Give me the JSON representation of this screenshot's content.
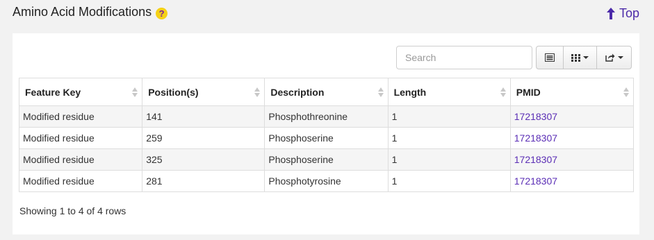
{
  "header": {
    "title": "Amino Acid Modifications",
    "help_glyph": "?",
    "top_label": "Top"
  },
  "toolbar": {
    "search_placeholder": "Search",
    "buttons": [
      "list-view-icon",
      "columns-icon",
      "export-icon"
    ]
  },
  "table": {
    "columns": [
      "Feature Key",
      "Position(s)",
      "Description",
      "Length",
      "PMID"
    ],
    "rows": [
      [
        "Modified residue",
        "141",
        "Phosphothreonine",
        "1",
        "17218307"
      ],
      [
        "Modified residue",
        "259",
        "Phosphoserine",
        "1",
        "17218307"
      ],
      [
        "Modified residue",
        "325",
        "Phosphoserine",
        "1",
        "17218307"
      ],
      [
        "Modified residue",
        "281",
        "Phosphotyrosine",
        "1",
        "17218307"
      ]
    ]
  },
  "footer": {
    "summary": "Showing 1 to 4 of 4 rows"
  },
  "colors": {
    "link": "#5a2db5",
    "top_link": "#4b2aa8",
    "help_bg": "#f5d117"
  }
}
